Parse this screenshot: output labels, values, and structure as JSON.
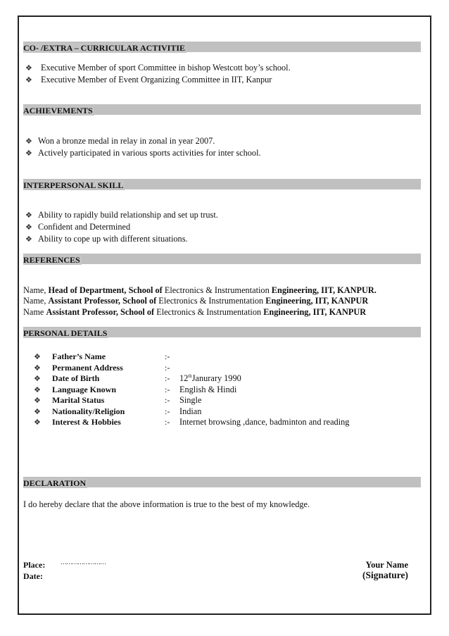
{
  "bullet_glyph": "❖",
  "sections": {
    "activities": {
      "heading": "CO- /EXTRA – CURRICULAR ACTIVITIE",
      "items": [
        "Executive Member of sport Committee in bishop Westcott boy’s school.",
        "Executive Member of Event Organizing Committee in  IIT, Kanpur"
      ]
    },
    "achievements": {
      "heading": "ACHIEVEMENTS",
      "items": [
        "Won a bronze medal in relay in zonal in year 2007.",
        "Actively participated in various sports activities for inter school."
      ]
    },
    "interpersonal": {
      "heading": "INTERPERSONAL SKILL",
      "items": [
        "Ability to rapidly build relationship and set up trust.",
        "Confident and Determined",
        "Ability to cope up with different situations."
      ]
    },
    "references": {
      "heading": "REFERENCES",
      "rows": [
        {
          "p1": "Name, ",
          "b1": "Head of Department, School of",
          "p2": " Electronics & Instrumentation ",
          "b2": "Engineering, IIT, KANPUR."
        },
        {
          "p1": "Name, ",
          "b1": "Assistant Professor, School of",
          "p2": " Electronics & Instrumentation ",
          "b2": "Engineering, IIT, KANPUR"
        },
        {
          "p1": "Name ",
          "b1": "Assistant Professor, School of",
          "p2": " Electronics & Instrumentation ",
          "b2": "Engineering, IIT, KANPUR"
        }
      ]
    },
    "personal": {
      "heading": "PERSONAL DETAILS",
      "separator": ":-",
      "rows": [
        {
          "label": "Father’s Name",
          "value": ""
        },
        {
          "label": "Permanent Address",
          "value": ""
        },
        {
          "label": "Date of Birth",
          "value_pre": "12",
          "value_sup": "th",
          "value": "Janurary 1990"
        },
        {
          "label": "Language Known",
          "value": "English & Hindi"
        },
        {
          "label": "Marital Status",
          "value": "Single"
        },
        {
          "label": "Nationality/Religion",
          "value": "Indian"
        },
        {
          "label": "Interest & Hobbies",
          "value": "Internet browsing ,dance, badminton and reading"
        }
      ]
    },
    "declaration": {
      "heading": "DECLARATION",
      "text": "I do hereby declare that the above information is true to the best of my knowledge."
    }
  },
  "footer": {
    "place_label": "Place:",
    "place_value": "……………………",
    "date_label": "Date:",
    "name": "Your Name",
    "signature": "(Signature)"
  }
}
